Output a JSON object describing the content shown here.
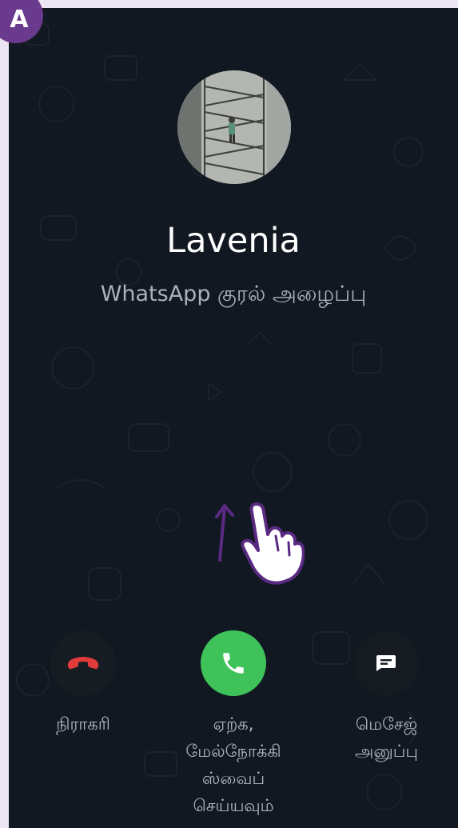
{
  "badge": {
    "letter": "A"
  },
  "caller": {
    "name": "Lavenia",
    "call_type": "WhatsApp குரல் அழைப்பு"
  },
  "actions": {
    "decline_label": "நிராகரி",
    "accept_label_lines": [
      "ஏற்க,",
      "மேல்நோக்கி",
      "ஸ்வைப்",
      "செய்யவும்"
    ],
    "message_label_lines": [
      "மெசேஜ்",
      "அனுப்பு"
    ]
  },
  "icons": {
    "decline": "phone-hangup-icon",
    "accept": "phone-icon",
    "message": "message-icon",
    "gesture": "swipe-up-hand-icon"
  },
  "colors": {
    "background": "#111821",
    "accept": "#3fc25a",
    "decline_icon": "#e23b3b",
    "badge": "#6a3a8e",
    "gesture": "#5a2a82"
  }
}
